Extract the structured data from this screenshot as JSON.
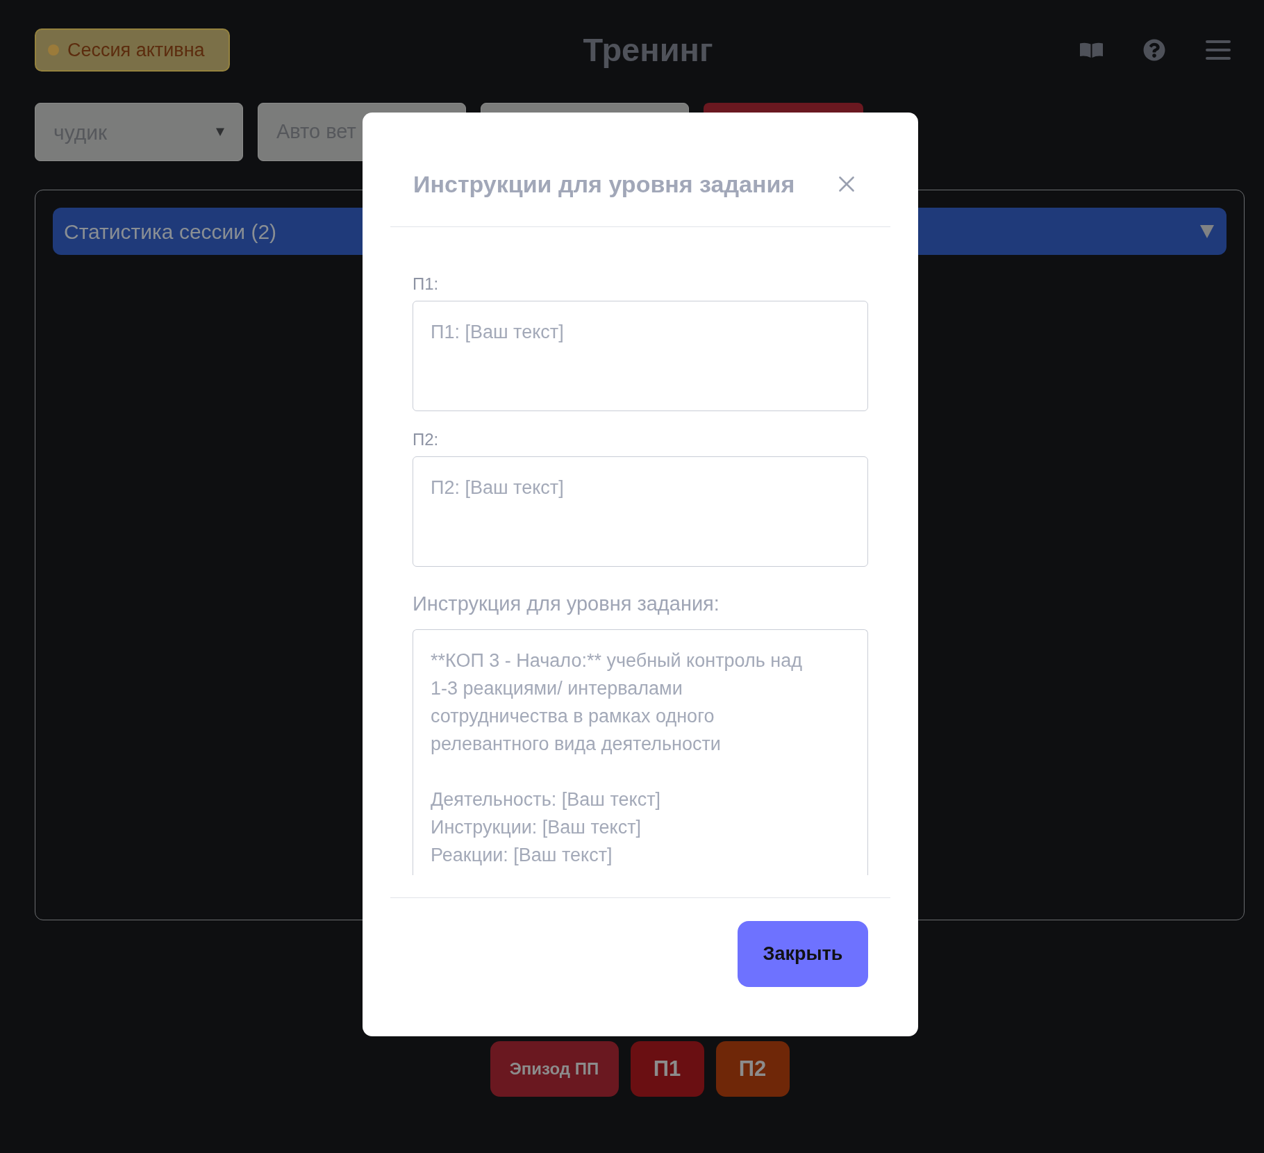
{
  "header": {
    "status": {
      "label": "Сессия активна",
      "active": true
    },
    "title": "Тренинг"
  },
  "toolbar": [
    {
      "kind": "select",
      "value": "чудик"
    },
    {
      "kind": "field",
      "value": "Авто вет"
    },
    {
      "kind": "field"
    },
    {
      "kind": "button"
    }
  ],
  "panel": {
    "section_title": "Статистика сессии (2)"
  },
  "dialog": {
    "title": "Инструкции для уровня задания",
    "fields": [
      {
        "label": "П1:",
        "placeholder": "П1: [Ваш текст]"
      },
      {
        "label": "П2:",
        "placeholder": "П2: [Ваш текст]"
      },
      {
        "label": "Инструкция для уровня задания:",
        "placeholder": "**КОП 3 - Начало:** учебный контроль над 1-3 реакциями/ интервалами сотрудничества в рамках одного релевантного вида деятельности\n\nДеятельность: [Ваш текст]\nИнструкции: [Ваш текст]\nРеакции: [Ваш текст]"
      }
    ],
    "buttons": [
      "Закрыть"
    ]
  },
  "actions": [
    {
      "label": "Эпизод ПП",
      "color": "#6a1820"
    },
    {
      "label": "П1",
      "color": "#6a0f12"
    },
    {
      "label": "П2",
      "color": "#6f2708"
    }
  ]
}
